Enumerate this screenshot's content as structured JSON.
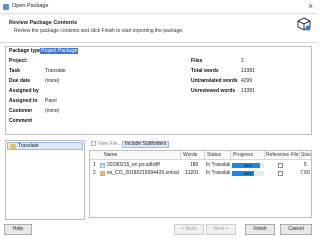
{
  "window": {
    "title": "Open Package",
    "close_glyph": "×"
  },
  "header": {
    "title": "Review Package Contents",
    "subtitle": "Review the package contents and click Finish to start importing the package.",
    "icon": "package-box-icon"
  },
  "info": {
    "package_type_label": "Package type:",
    "package_type_value": "Project Package",
    "project_label": "Project:",
    "project_value": "",
    "task_label": "Task",
    "task_value": "Translate",
    "due_date_label": "Due date",
    "due_date_value": "(none)",
    "assigned_by_label": "Assigned by",
    "assigned_by_value": "",
    "assigned_to_label": "Assigned to",
    "assigned_to_value": "Parel",
    "customer_label": "Customer",
    "customer_value": "(none)",
    "comment_label": "Comment",
    "comment_value": "",
    "files_label": "Files",
    "files_value": "2",
    "total_words_label": "Total words",
    "total_words_value": "13381",
    "untranslated_label": "Untranslated words",
    "untranslated_value": "4299",
    "unreviewed_label": "Unreviewed words",
    "unreviewed_value": "13381"
  },
  "tree": {
    "items": [
      {
        "label": "Translate",
        "icon": "folder-icon"
      }
    ]
  },
  "toolbar": {
    "view_file": "View File...",
    "include_subfolders": "Include Subfolders"
  },
  "grid": {
    "columns": [
      "Name",
      "Words",
      "Status",
      "Progress",
      "Reference File",
      "Size"
    ],
    "rows": [
      {
        "index": "1",
        "name": "20180215_en.po.sdlxliff",
        "words": "180",
        "status": "In Translati...",
        "progress_label": "86%",
        "progress": 0.86,
        "reference_checked": false,
        "size": "5"
      },
      {
        "index": "2",
        "name": "es_CO_20180215094420.xmlsdl...",
        "words": "13201",
        "status": "In Translati...",
        "progress_label": "68%",
        "progress": 0.68,
        "reference_checked": false,
        "size": "7.60"
      }
    ],
    "progress_color": "#1e88e5"
  },
  "footer": {
    "help": "Help",
    "back": "< Back",
    "next": "Next >",
    "finish": "Finish",
    "cancel": "Cancel"
  }
}
